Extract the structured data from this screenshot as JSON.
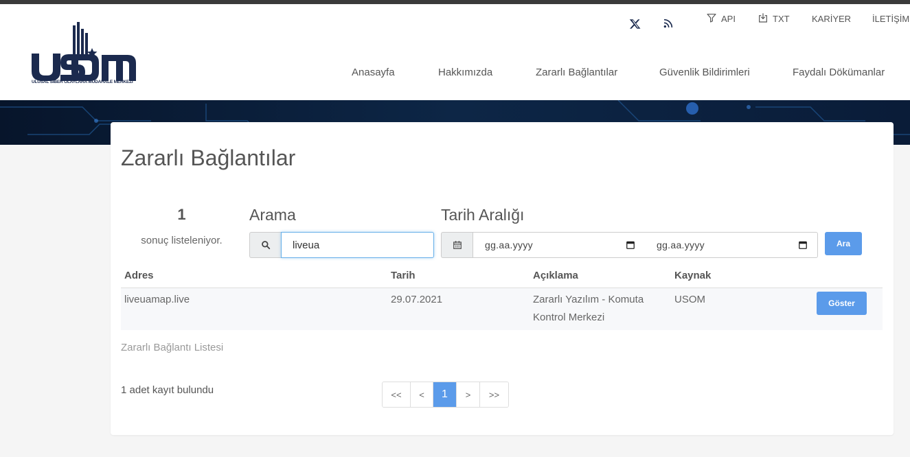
{
  "header": {
    "logo_text": "usom",
    "logo_subtitle": "ULUSAL SİBER OLAYLARA MÜDAHALE MERKEZİ",
    "utility": {
      "api_label": "API",
      "txt_label": "TXT",
      "kariyer_label": "KARİYER",
      "iletisim_label": "İLETİŞİM"
    },
    "nav": [
      {
        "label": "Anasayfa"
      },
      {
        "label": "Hakkımızda"
      },
      {
        "label": "Zararlı Bağlantılar"
      },
      {
        "label": "Güvenlik Bildirimleri"
      },
      {
        "label": "Faydalı Dökümanlar"
      }
    ]
  },
  "main": {
    "title": "Zararlı Bağlantılar",
    "result_count": "1",
    "result_label": "sonuç listeleniyor.",
    "search_label": "Arama",
    "search_value": "liveua",
    "date_range_label": "Tarih Aralığı",
    "date_start_placeholder": "gg.aa.yyyy",
    "date_end_placeholder": "gg.aa.yyyy",
    "search_button": "Ara",
    "table": {
      "columns": [
        "Adres",
        "Tarih",
        "Açıklama",
        "Kaynak"
      ],
      "rows": [
        {
          "address": "liveuamap.live",
          "date": "29.07.2021",
          "description": "Zararlı Yazılım - Komuta Kontrol Merkezi",
          "source": "USOM",
          "action": "Göster"
        }
      ]
    },
    "list_link": "Zararlı Bağlantı Listesi",
    "records_found": "1 adet kayıt bulundu",
    "pagination": [
      "<<",
      "<",
      "1",
      ">",
      ">>"
    ]
  },
  "colors": {
    "accent": "#5b9bea",
    "logo": "#1b2a4e",
    "topbar": "#3a3a3a"
  }
}
